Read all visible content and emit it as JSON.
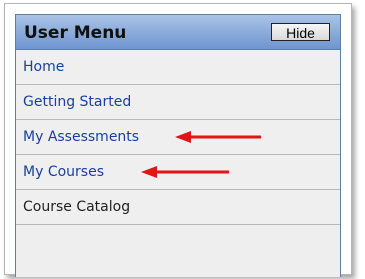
{
  "user_menu": {
    "title": "User Menu",
    "hide_label": "Hide",
    "items": [
      {
        "label": "Home"
      },
      {
        "label": "Getting Started"
      },
      {
        "label": "My Assessments"
      },
      {
        "label": "My Courses"
      },
      {
        "label": "Course Catalog"
      }
    ]
  },
  "colors": {
    "header_gradient_top": "#a9c3e6",
    "header_gradient_bottom": "#6f95cf",
    "link_blue": "#1a3f9c",
    "arrow_red": "#e01515",
    "row_background": "#efefef"
  },
  "icons": {
    "annotation_arrow_1": "red-left-arrow-icon",
    "annotation_arrow_2": "red-left-arrow-icon"
  }
}
